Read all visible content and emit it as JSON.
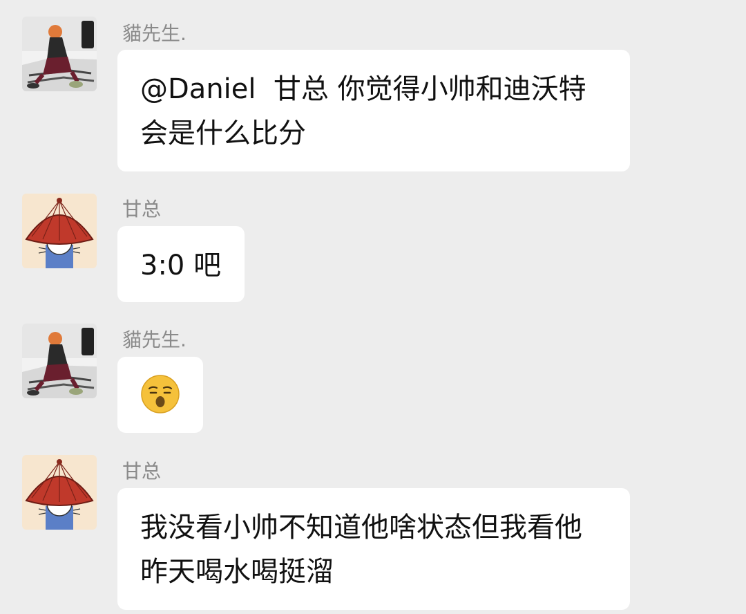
{
  "messages": [
    {
      "sender": "貓先生.",
      "avatar": "anime-character-avatar",
      "text": "@Daniel  甘总 你觉得小帅和迪沃特会是什么比分"
    },
    {
      "sender": "甘总",
      "avatar": "red-hat-cartoon-avatar",
      "text": "3:0 吧"
    },
    {
      "sender": "貓先生.",
      "avatar": "anime-character-avatar",
      "emoji": "sleepy-face-emoji"
    },
    {
      "sender": "甘总",
      "avatar": "red-hat-cartoon-avatar",
      "text": "我没看小帅不知道他啥状态但我看他昨天喝水喝挺溜"
    }
  ],
  "colors": {
    "background": "#ededed",
    "bubble": "#ffffff",
    "sender_name": "#8a8a8a",
    "text": "#111111",
    "hat_red": "#c0392b"
  }
}
